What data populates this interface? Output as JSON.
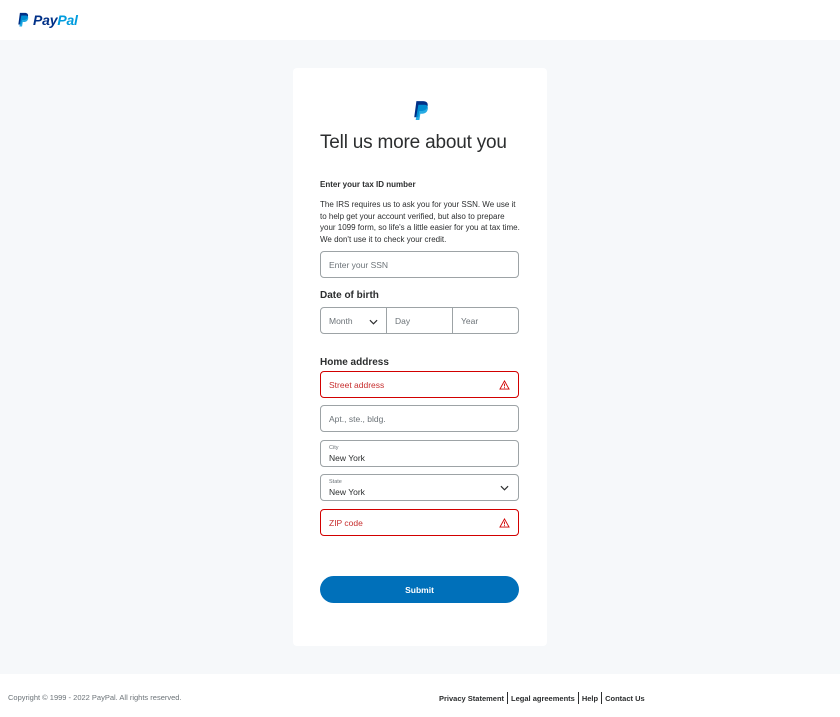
{
  "brand": {
    "name_pay": "Pay",
    "name_pal": "Pal",
    "colors": {
      "dark": "#003087",
      "light": "#009cde",
      "primary_button": "#0070ba",
      "error": "#d20000"
    }
  },
  "form": {
    "title": "Tell us more about you",
    "tax": {
      "heading": "Enter your tax ID number",
      "description": "The IRS requires us to ask you for your SSN. We use it to help get your account verified, but also to prepare your 1099 form, so life's a little easier for you at tax time. We don't use it to check your credit.",
      "ssn_placeholder": "Enter your SSN",
      "ssn_value": ""
    },
    "dob": {
      "label": "Date of birth",
      "month_placeholder": "Month",
      "day_placeholder": "Day",
      "year_placeholder": "Year"
    },
    "address": {
      "label": "Home address",
      "street_placeholder": "Street address",
      "apt_placeholder": "Apt., ste., bldg.",
      "city_label": "City",
      "city_value": "New York",
      "state_label": "State",
      "state_value": "New York",
      "zip_placeholder": "ZIP code"
    },
    "submit_label": "Submit"
  },
  "footer": {
    "copyright": "Copyright © 1999 - 2022 PayPal. All rights reserved.",
    "links": [
      "Privacy Statement",
      "Legal agreements",
      "Help",
      "Contact Us"
    ]
  }
}
